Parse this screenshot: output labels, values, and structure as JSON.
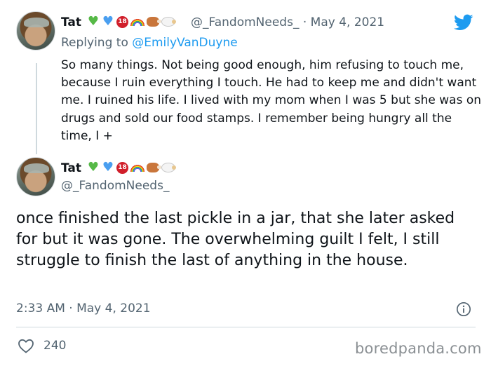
{
  "tweet1": {
    "name": "Tat",
    "handle": "@_FandomNeeds_",
    "separator": "·",
    "date": "May 4, 2021",
    "replying_prefix": "Replying to ",
    "replying_to": "@EmilyVanDuyne",
    "text": "So many things. Not being good enough, him refusing to touch me, because I ruin everything I touch. He had to keep me and didn't want me. I ruined his life. I lived with my mom when I was 5 but she was on drugs and sold our food stamps. I remember being hungry all the time, I +"
  },
  "tweet2": {
    "name": "Tat",
    "handle": "@_FandomNeeds_",
    "text": "once finished the last pickle in a jar, that she later asked for but it was gone. The overwhelming guilt I felt, I still struggle to finish the last of anything in the house.",
    "timestamp": "2:33 AM · May 4, 2021",
    "likes": "240"
  },
  "name_emojis": [
    "green-heart",
    "blue-heart",
    "18-badge",
    "rainbow",
    "meat-on-bone",
    "sheep"
  ],
  "badge_text": "18",
  "icons": {
    "brand": "twitter-bird-icon",
    "info": "info-icon",
    "like": "heart-outline-icon"
  },
  "colors": {
    "twitter_blue": "#1d9bf0",
    "secondary_text": "#536471"
  },
  "watermark": "boredpanda.com"
}
